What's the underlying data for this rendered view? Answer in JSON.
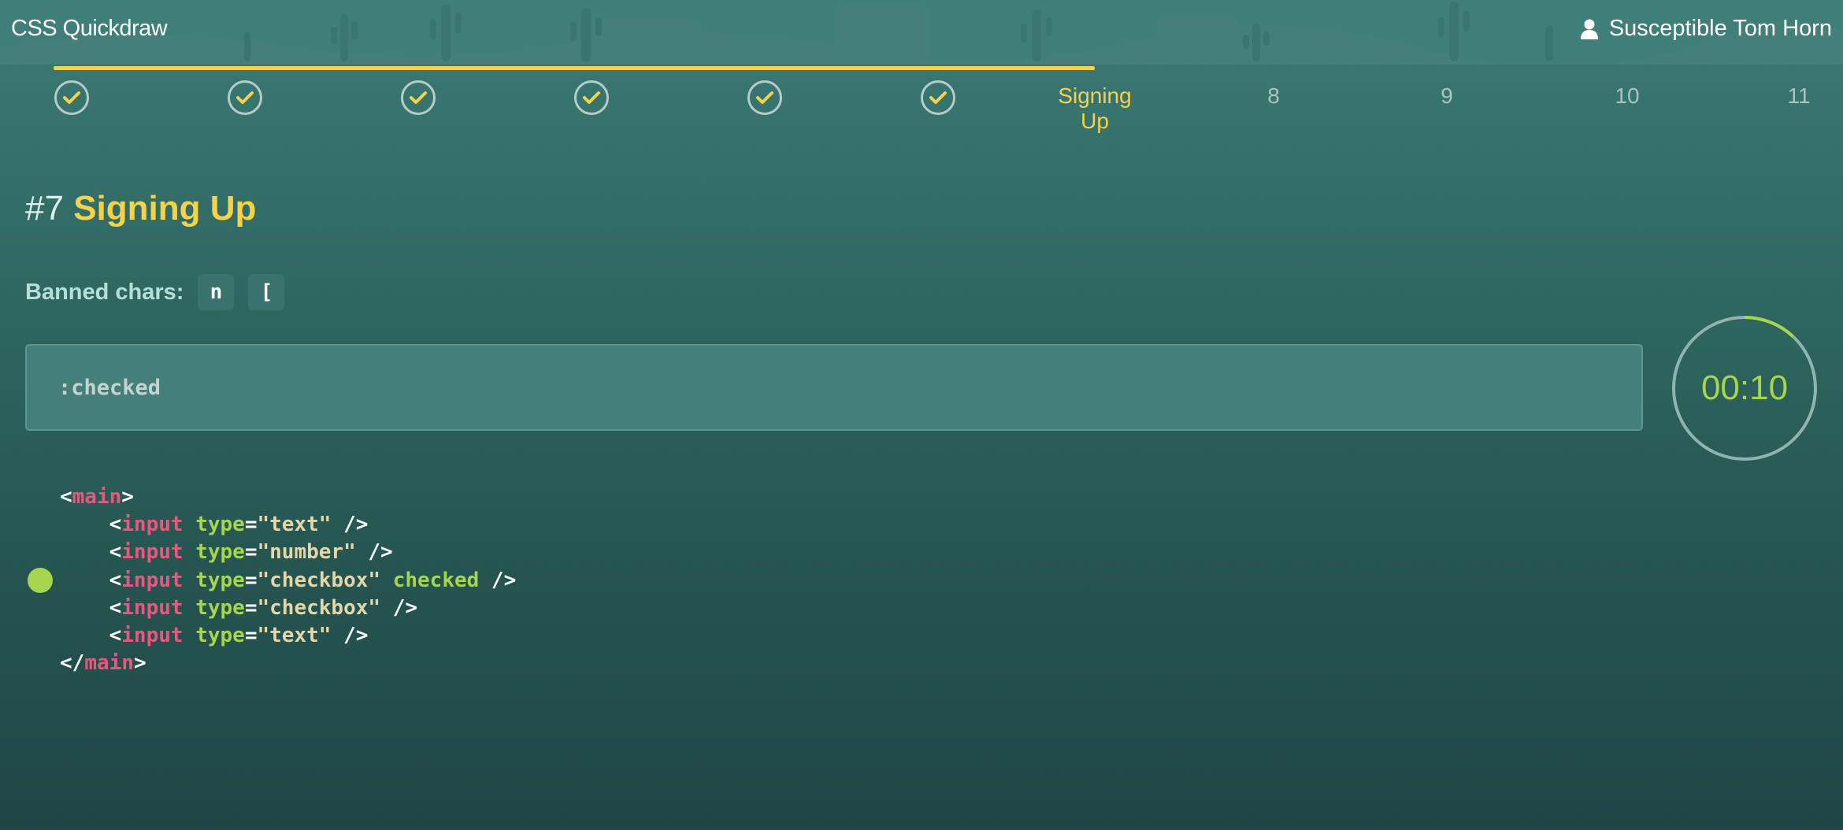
{
  "app": {
    "title": "CSS Quickdraw",
    "user_name": "Susceptible Tom Horn"
  },
  "progress": {
    "completed_fraction": 0.6,
    "completed_steps": 6,
    "current_label": "Signing Up",
    "upcoming": [
      "8",
      "9",
      "10",
      "11"
    ]
  },
  "level": {
    "number": "#7",
    "name": "Signing Up"
  },
  "banned": {
    "label": "Banned chars:",
    "chars": [
      "n",
      "["
    ]
  },
  "selector": {
    "value": ":checked"
  },
  "timer": {
    "text": "00:10",
    "remaining_fraction": 0.12
  },
  "code": {
    "lines": [
      {
        "indent": "",
        "tokens": [
          [
            "p",
            "<"
          ],
          [
            "tag",
            "main"
          ],
          [
            "p",
            ">"
          ]
        ]
      },
      {
        "indent": "    ",
        "tokens": [
          [
            "p",
            "<"
          ],
          [
            "tag",
            "input"
          ],
          [
            "p",
            " "
          ],
          [
            "attr",
            "type"
          ],
          [
            "p",
            "="
          ],
          [
            "str",
            "\"text\""
          ],
          [
            "p",
            " />"
          ]
        ]
      },
      {
        "indent": "    ",
        "tokens": [
          [
            "p",
            "<"
          ],
          [
            "tag",
            "input"
          ],
          [
            "p",
            " "
          ],
          [
            "attr",
            "type"
          ],
          [
            "p",
            "="
          ],
          [
            "str",
            "\"number\""
          ],
          [
            "p",
            " />"
          ]
        ]
      },
      {
        "indent": "    ",
        "tokens": [
          [
            "p",
            "<"
          ],
          [
            "tag",
            "input"
          ],
          [
            "p",
            " "
          ],
          [
            "attr",
            "type"
          ],
          [
            "p",
            "="
          ],
          [
            "str",
            "\"checkbox\""
          ],
          [
            "p",
            " "
          ],
          [
            "kw",
            "checked"
          ],
          [
            "p",
            " />"
          ]
        ],
        "target": true
      },
      {
        "indent": "    ",
        "tokens": [
          [
            "p",
            "<"
          ],
          [
            "tag",
            "input"
          ],
          [
            "p",
            " "
          ],
          [
            "attr",
            "type"
          ],
          [
            "p",
            "="
          ],
          [
            "str",
            "\"checkbox\""
          ],
          [
            "p",
            " />"
          ]
        ]
      },
      {
        "indent": "    ",
        "tokens": [
          [
            "p",
            "<"
          ],
          [
            "tag",
            "input"
          ],
          [
            "p",
            " "
          ],
          [
            "attr",
            "type"
          ],
          [
            "p",
            "="
          ],
          [
            "str",
            "\"text\""
          ],
          [
            "p",
            " />"
          ]
        ]
      },
      {
        "indent": "",
        "tokens": [
          [
            "p",
            "</"
          ],
          [
            "tag",
            "main"
          ],
          [
            "p",
            ">"
          ]
        ]
      }
    ]
  },
  "colors": {
    "accent_yellow": "#f5d24a",
    "accent_green": "#a6d54e",
    "tag_pink": "#e8577d",
    "string_tan": "#e4d6a7"
  }
}
